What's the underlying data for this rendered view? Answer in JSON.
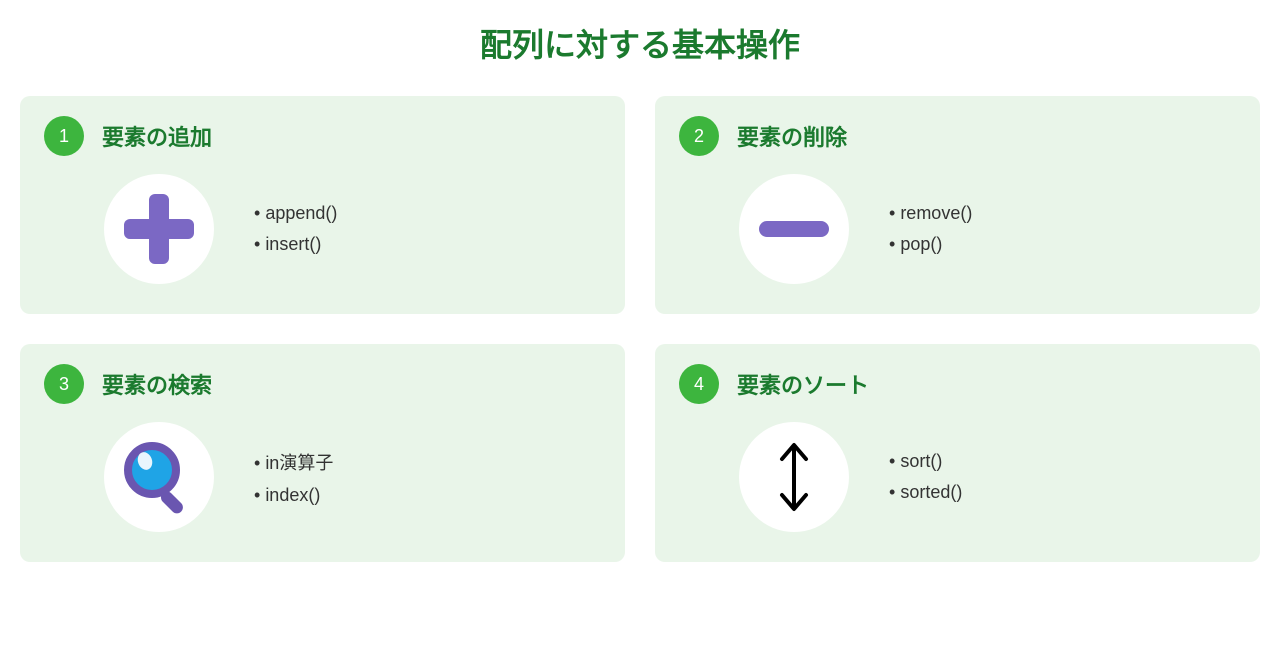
{
  "title": "配列に対する基本操作",
  "cards": [
    {
      "num": "1",
      "title": "要素の追加",
      "icon": "plus",
      "items": [
        "append()",
        "insert()"
      ]
    },
    {
      "num": "2",
      "title": "要素の削除",
      "icon": "minus",
      "items": [
        "remove()",
        "pop()"
      ]
    },
    {
      "num": "3",
      "title": "要素の検索",
      "icon": "search",
      "items": [
        "in演算子",
        "index()"
      ]
    },
    {
      "num": "4",
      "title": "要素のソート",
      "icon": "sort",
      "items": [
        "sort()",
        "sorted()"
      ]
    }
  ],
  "colors": {
    "accent": "#1b7a2e",
    "badge": "#3db53e",
    "cardBg": "#e9f5e9",
    "iconPurple": "#7b68c4"
  }
}
